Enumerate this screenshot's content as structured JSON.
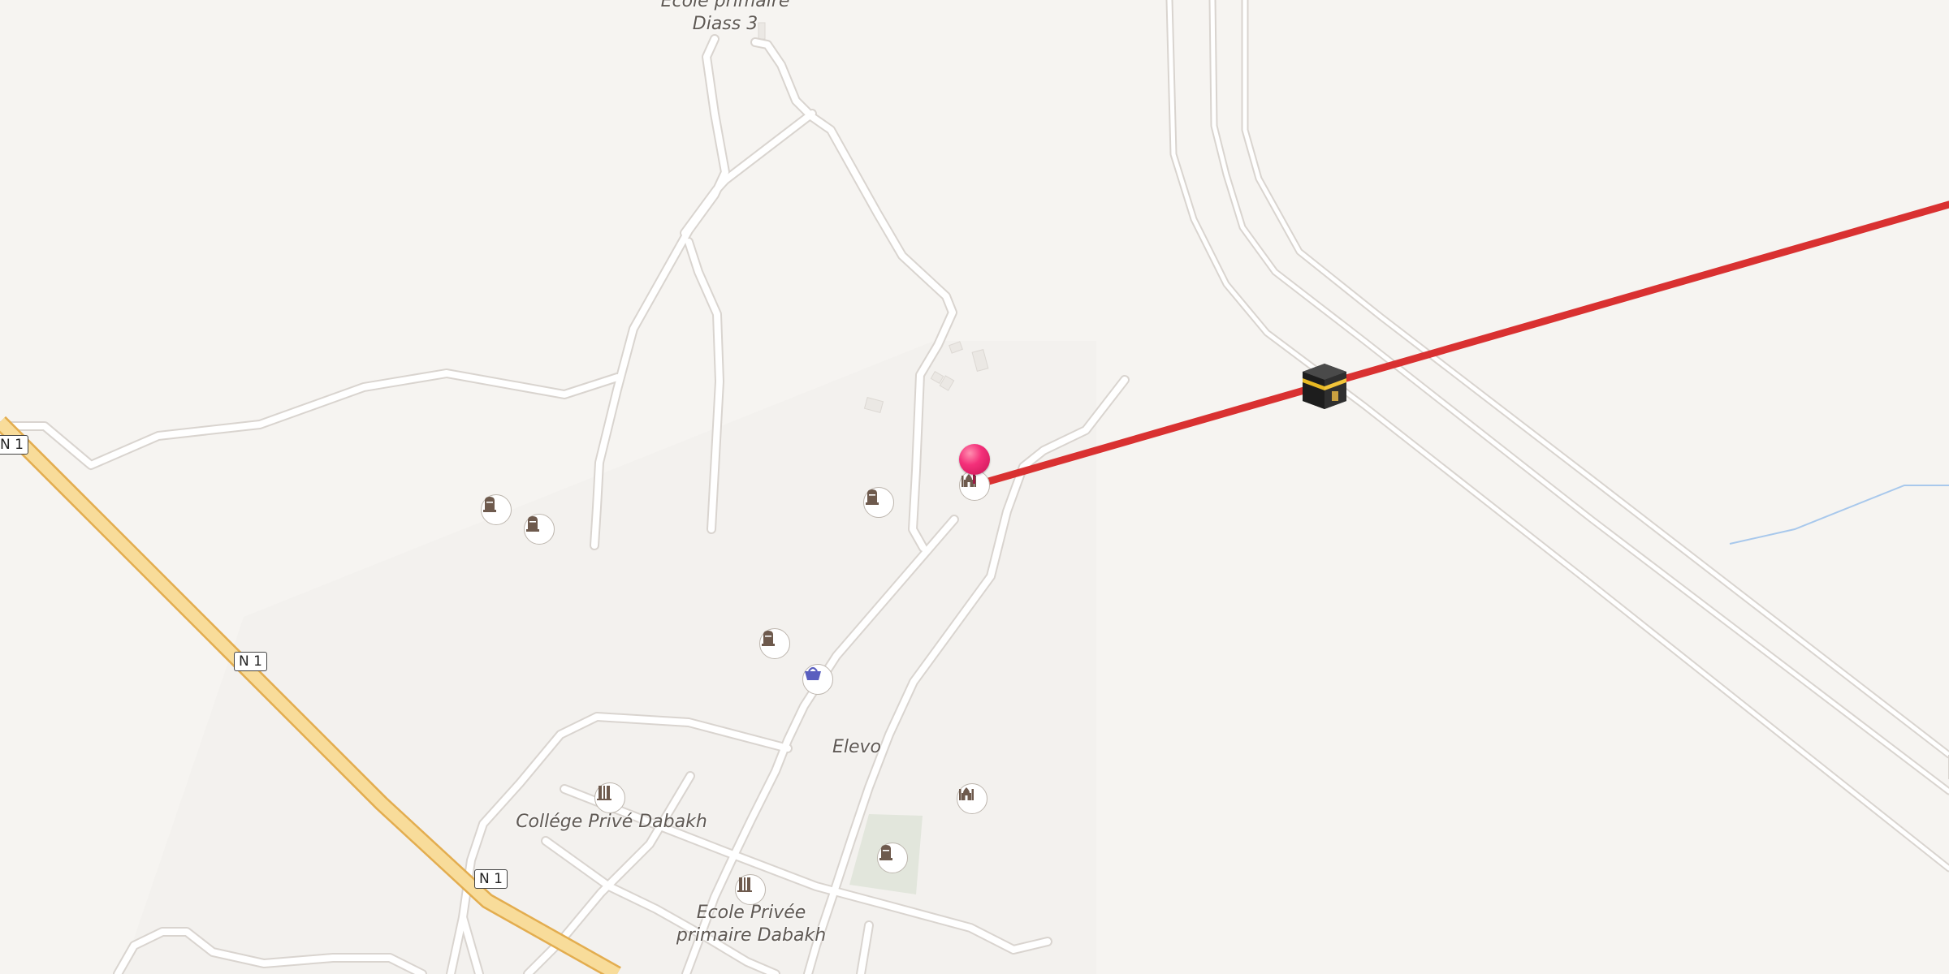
{
  "map": {
    "road_shields": [
      {
        "id": "n1-left",
        "text": "N 1"
      },
      {
        "id": "n1-mid",
        "text": "N 1"
      },
      {
        "id": "n1-bottom",
        "text": "N 1"
      }
    ],
    "place_labels": [
      {
        "id": "ecole-diass",
        "lines": [
          "Ecole primaire",
          "Diass 3"
        ]
      },
      {
        "id": "elevo",
        "lines": [
          "Elevo"
        ]
      },
      {
        "id": "college-dabakh",
        "lines": [
          "Collége Privé Dabakh"
        ]
      },
      {
        "id": "ecole-privee-dabakh",
        "lines": [
          "Ecole Privée",
          "primaire Dabakh"
        ]
      }
    ],
    "icons": [
      {
        "id": "cemetery-1",
        "icon": "cemetery-icon"
      },
      {
        "id": "cemetery-2",
        "icon": "cemetery-icon"
      },
      {
        "id": "cemetery-3",
        "icon": "cemetery-icon"
      },
      {
        "id": "cemetery-4",
        "icon": "cemetery-icon"
      },
      {
        "id": "cemetery-5",
        "icon": "cemetery-icon"
      },
      {
        "id": "mosque-1",
        "icon": "mosque-icon"
      },
      {
        "id": "mosque-2",
        "icon": "mosque-icon"
      },
      {
        "id": "shop-1",
        "icon": "shopping-basket-icon"
      },
      {
        "id": "school-1",
        "icon": "school-icon"
      },
      {
        "id": "school-2",
        "icon": "school-icon"
      }
    ],
    "markers": {
      "location_pin": "location-pin-icon",
      "qibla_target": "kaaba-icon"
    },
    "colors": {
      "background": "#f6f4f1",
      "road_casing": "#d9d4cf",
      "road_fill": "#ffffff",
      "trunk_road": "#f8dc9a",
      "trunk_casing": "#e3ad4f",
      "qibla_line": "#d93131",
      "pin": "#f4307a",
      "water": "#a8c8ec",
      "park": "#e2e6dc",
      "icon_brown": "#6e5a4d",
      "shop_blue": "#5a5fbf"
    }
  }
}
